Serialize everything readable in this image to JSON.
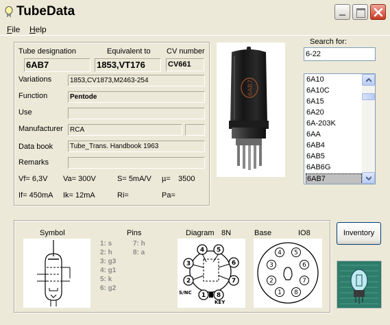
{
  "window": {
    "title": "TubeData"
  },
  "menu": {
    "file": "File",
    "help": "Help"
  },
  "header_labels": {
    "tube_designation": "Tube designation",
    "equivalent_to": "Equivalent to",
    "cv_number": "CV number"
  },
  "tube": {
    "designation": "6AB7",
    "equivalent": "1853,VT176",
    "cv": "CV661",
    "variations": "1853,CV1873,M2463-254",
    "function": "Pentode",
    "use": "",
    "manufacturer": "RCA",
    "manufacturer_extra": "",
    "data_book": "Tube_Trans. Handbook 1963",
    "remarks": ""
  },
  "field_labels": {
    "variations": "Variations",
    "function": "Function",
    "use": "Use",
    "manufacturer": "Manufacturer",
    "data_book": "Data book",
    "remarks": "Remarks"
  },
  "params": {
    "vf": "Vf= 6,3V",
    "va": "Va= 300V",
    "s": "S= 5mA/V",
    "mu_label": "µ=",
    "mu_value": "3500",
    "if": "If= 450mA",
    "ik": "Ik= 12mA",
    "ri": "Ri=",
    "pa": "Pa="
  },
  "search": {
    "label": "Search for:",
    "value": "6-22"
  },
  "tube_list": [
    "6A10",
    "6A10C",
    "6A15",
    "6A20",
    "6A-203K",
    "6AA",
    "6AB4",
    "6AB5",
    "6AB6G",
    "6AB7"
  ],
  "selected_tube": "6AB7",
  "section_labels": {
    "symbol": "Symbol",
    "pins": "Pins",
    "diagram": "Diagram",
    "diagram_code": "8N",
    "base": "Base",
    "base_code": "IO8"
  },
  "pins_col1": [
    "1: s",
    "2: h",
    "3: g3",
    "4: g1",
    "5: k",
    "6: g2"
  ],
  "pins_col2": [
    "7: h",
    "8: a"
  ],
  "diagram_labels": {
    "sinc": "S/NC",
    "key": "KEY"
  },
  "tube_marking": "6AB7",
  "buttons": {
    "inventory": "Inventory"
  },
  "icons": [
    "app-tube-icon",
    "minimize-icon",
    "maximize-icon",
    "close-icon",
    "scroll-up-icon",
    "scroll-down-icon",
    "tubedata-logo"
  ]
}
